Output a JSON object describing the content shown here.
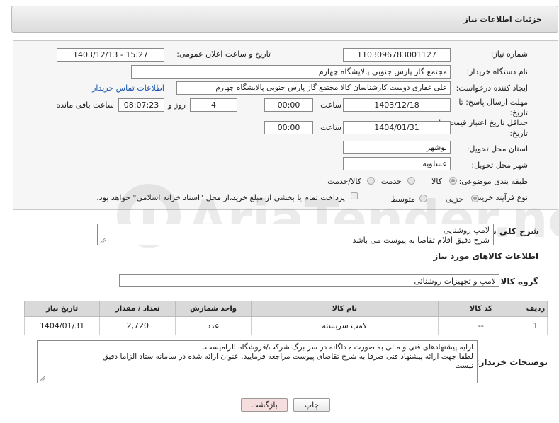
{
  "header": {
    "title": "جزئیات اطلاعات نیاز"
  },
  "form": {
    "need_number": {
      "label": "شماره نیاز:",
      "value": "1103096783001127"
    },
    "announce": {
      "label": "تاریخ و ساعت اعلان عمومی:",
      "value": "1403/12/13 - 15:27"
    },
    "buyer": {
      "label": "نام دستگاه خریدار:",
      "value": "مجتمع گاز پارس جنوبی  پالایشگاه چهارم"
    },
    "requester": {
      "label": "ایجاد کننده درخواست:",
      "value": "علی غفاری دوست کارشناسان کالا مجتمع گاز پارس جنوبی  پالایشگاه چهارم",
      "contact_link": "اطلاعات تماس خریدار"
    },
    "deadline": {
      "label_line1": "مهلت ارسال پاسخ: تا",
      "label_line2": "تاریخ:",
      "date": "1403/12/18",
      "time_label": "ساعت",
      "time": "00:00",
      "days": "4",
      "days_label": "روز و",
      "remaining": "08:07:23",
      "remaining_label": "ساعت باقی مانده"
    },
    "validity": {
      "label_line1": "حداقل تاریخ اعتبار قیمت: تا",
      "label_line2": "تاریخ:",
      "date": "1404/01/31",
      "time_label": "ساعت",
      "time": "00:00"
    },
    "province": {
      "label": "استان محل تحویل:",
      "value": "بوشهر"
    },
    "city": {
      "label": "شهر محل تحویل:",
      "value": "عسلویه"
    },
    "category": {
      "label": "طبقه بندی موضوعی:",
      "options": [
        "کالا",
        "خدمت",
        "کالا/خدمت"
      ],
      "selected": "کالا"
    },
    "process": {
      "label": "نوع فرآیند خرید :",
      "options": [
        "جزیی",
        "متوسط"
      ],
      "selected": "جزیی",
      "note": "پرداخت تمام یا بخشی از مبلغ خرید،از محل \"اسناد خزانه اسلامی\" خواهد بود."
    }
  },
  "description": {
    "label": "شرح کلی نیاز:",
    "line1": "لامپ روشنایی",
    "line2": "شرح دقیق اقلام تقاضا به پیوست می باشد"
  },
  "goods_section": {
    "title": "اطلاعات کالاهای مورد نیاز",
    "group_label": "گروه کالا:",
    "group_value": "لامپ و تجهیزات روشنائی"
  },
  "table": {
    "headers": [
      "ردیف",
      "کد کالا",
      "نام کالا",
      "واحد شمارش",
      "تعداد / مقدار",
      "تاریخ نیاز"
    ],
    "rows": [
      [
        "1",
        "--",
        "لامپ سربسته",
        "عدد",
        "2,720",
        "1404/01/31"
      ]
    ]
  },
  "buyer_notes": {
    "label": "توضیحات خریدار:",
    "line1": "ارایه پیشنهادهای فنی و مالی به صورت جداگانه در سر برگ شرکت/فروشگاه الزامیست.",
    "line2": "لطفا جهت ارائه پیشنهاد فنی صرفا به شرح تقاضای پیوست مراجعه فرمایید. عنوان ارائه شده در سامانه ستاد الزاما دقیق",
    "line3": "نیست"
  },
  "buttons": {
    "print": "چاپ",
    "back": "بازگشت"
  },
  "watermark": {
    "text": "AriaTender.neT"
  },
  "colors": {
    "link": "#1a55b0",
    "back_button": "#f6dede",
    "header_from": "#f3f3f3",
    "header_to": "#dcdcdc"
  }
}
